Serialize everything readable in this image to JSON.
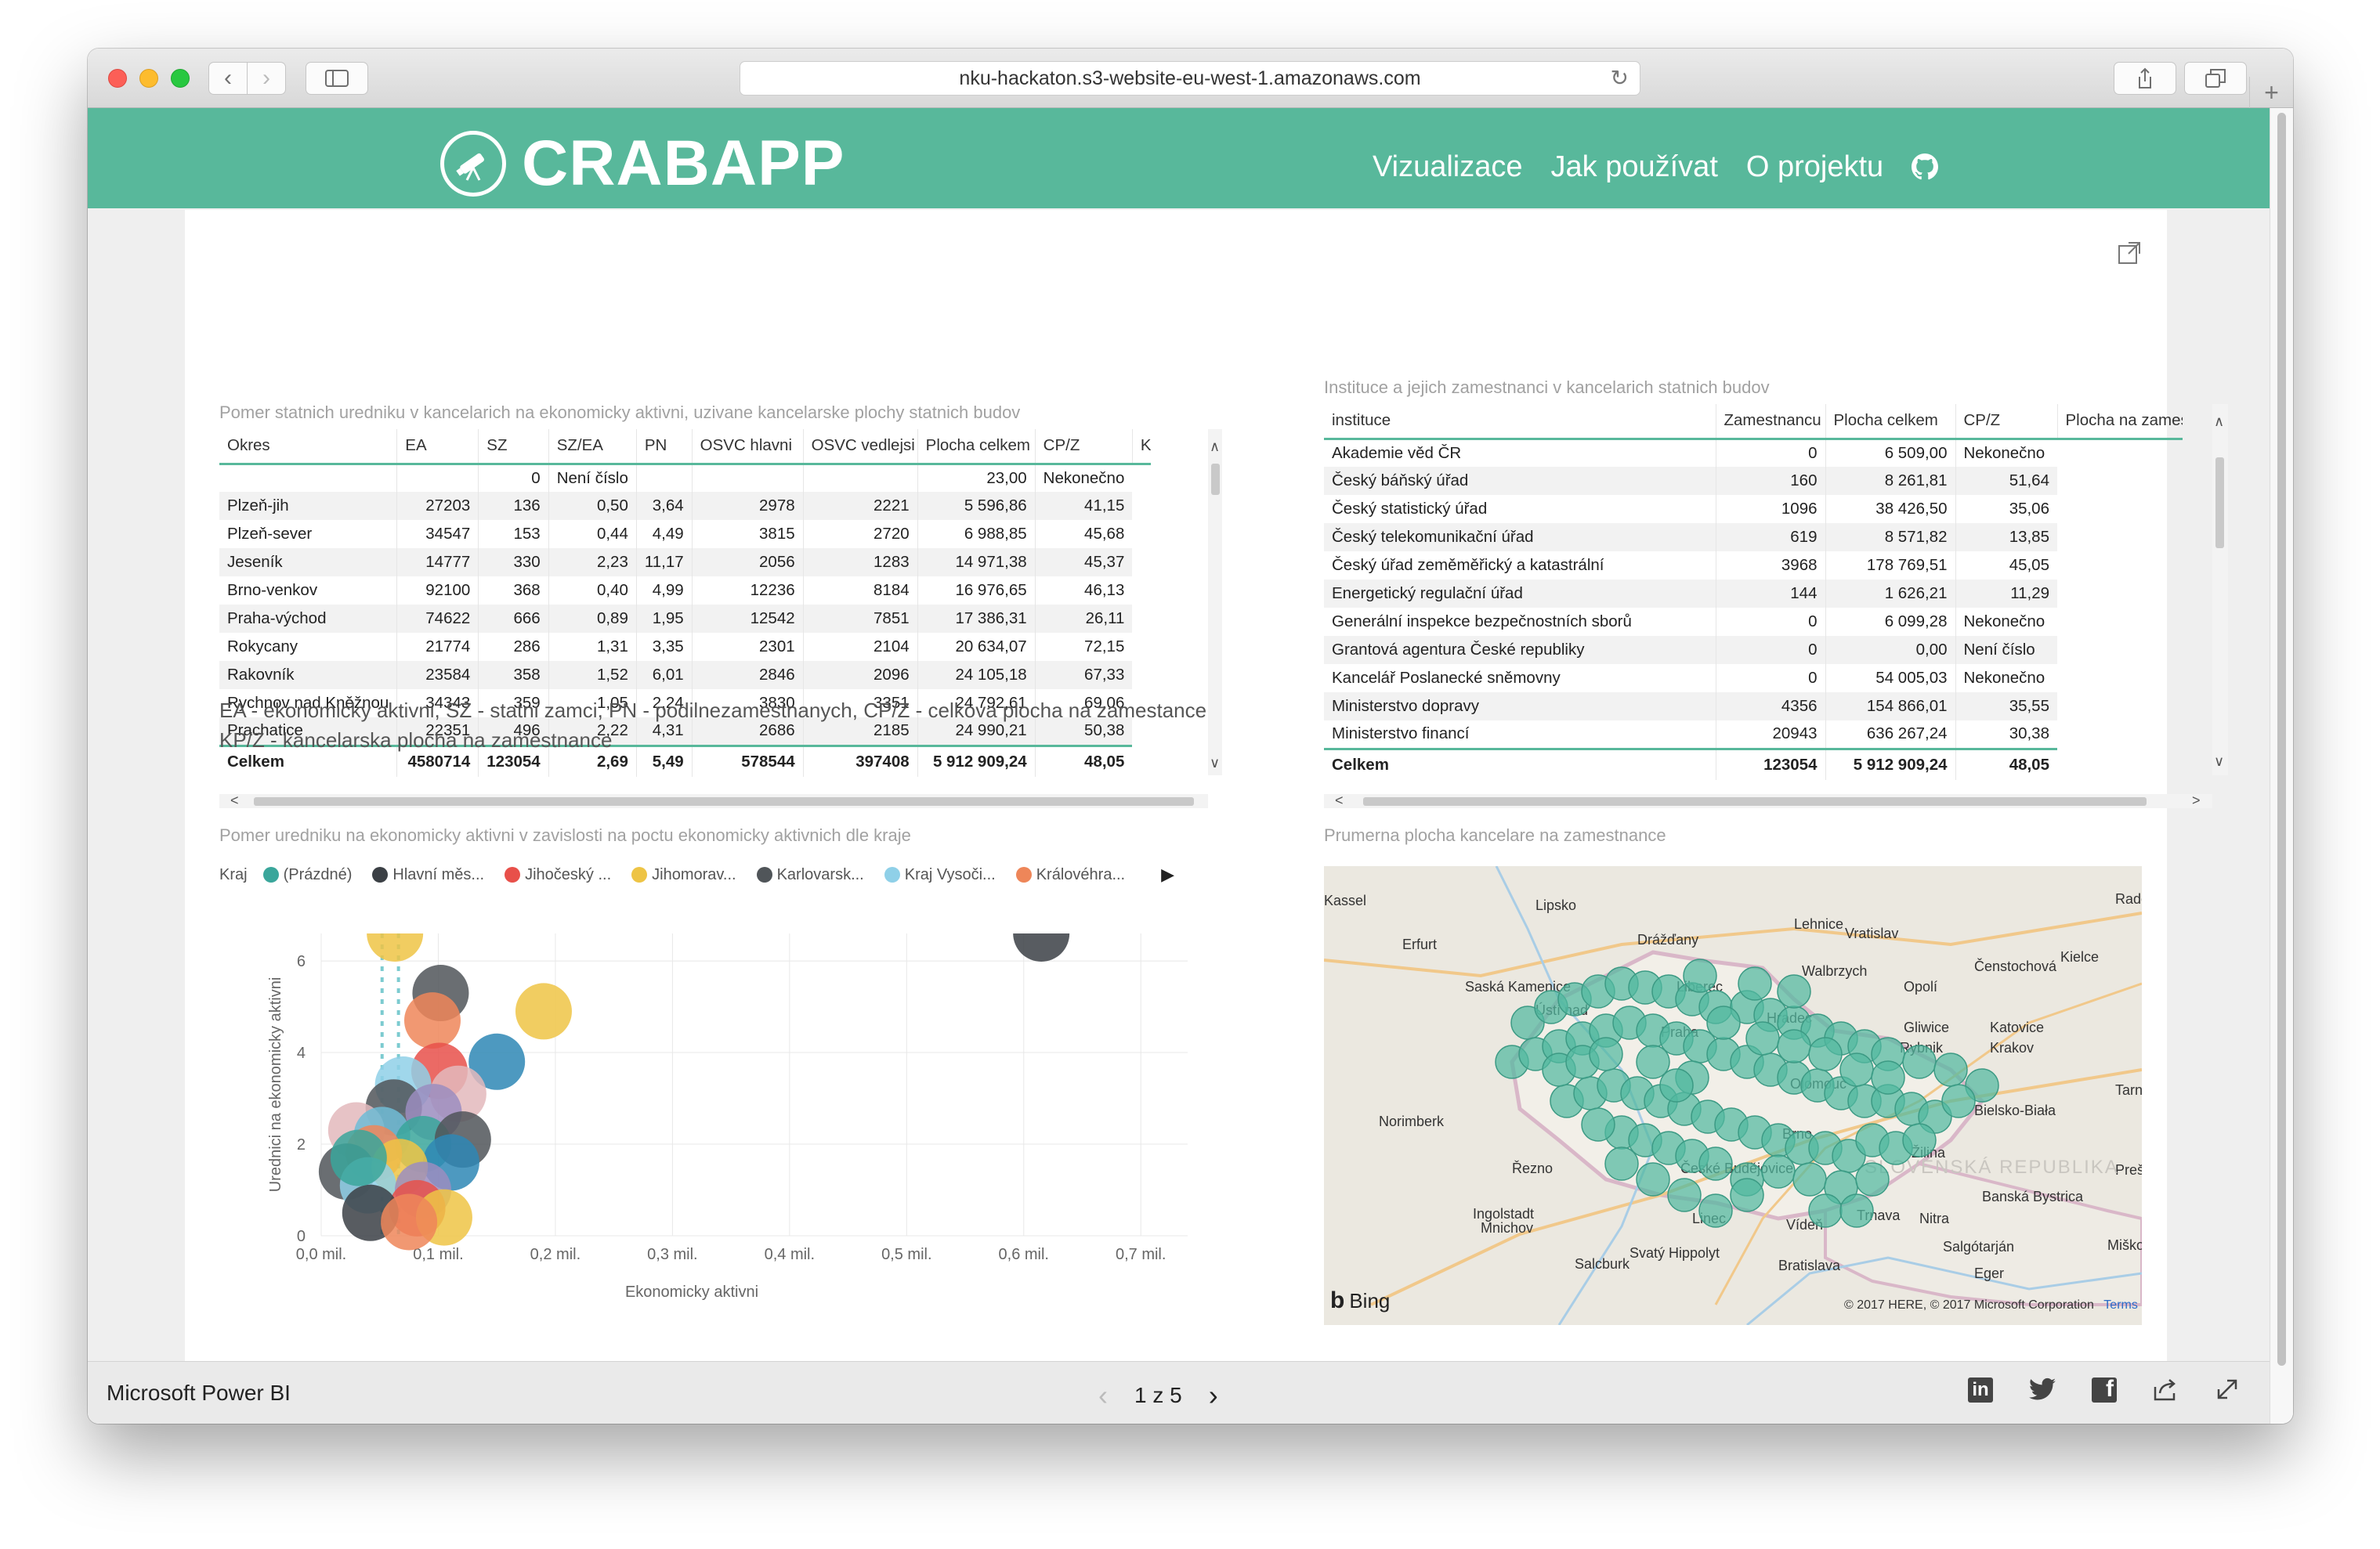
{
  "browser": {
    "url": "nku-hackaton.s3-website-eu-west-1.amazonaws.com"
  },
  "site": {
    "logo": "CRABAPP",
    "nav": [
      "Vizualizace",
      "Jak používat",
      "O projektu"
    ]
  },
  "table1": {
    "title": "Pomer statnich uredniku v kancelarich na ekonomicky aktivni, uzivane kancelarske plochy statnich budov",
    "columns": [
      "Okres",
      "EA",
      "SZ",
      "SZ/EA",
      "PN",
      "OSVC hlavni",
      "OSVC vedlejsi",
      "Plocha celkem",
      "CP/Z",
      "K"
    ],
    "rows": [
      [
        "",
        "",
        "0",
        "Není číslo",
        "",
        "",
        "",
        "23,00",
        "Nekonečno"
      ],
      [
        "Plzeň-jih",
        "27203",
        "136",
        "0,50",
        "3,64",
        "2978",
        "2221",
        "5 596,86",
        "41,15"
      ],
      [
        "Plzeň-sever",
        "34547",
        "153",
        "0,44",
        "4,49",
        "3815",
        "2720",
        "6 988,85",
        "45,68"
      ],
      [
        "Jeseník",
        "14777",
        "330",
        "2,23",
        "11,17",
        "2056",
        "1283",
        "14 971,38",
        "45,37"
      ],
      [
        "Brno-venkov",
        "92100",
        "368",
        "0,40",
        "4,99",
        "12236",
        "8184",
        "16 976,65",
        "46,13"
      ],
      [
        "Praha-východ",
        "74622",
        "666",
        "0,89",
        "1,95",
        "12542",
        "7851",
        "17 386,31",
        "26,11"
      ],
      [
        "Rokycany",
        "21774",
        "286",
        "1,31",
        "3,35",
        "2301",
        "2104",
        "20 634,07",
        "72,15"
      ],
      [
        "Rakovník",
        "23584",
        "358",
        "1,52",
        "6,01",
        "2846",
        "2096",
        "24 105,18",
        "67,33"
      ],
      [
        "Rychnov nad Kněžnou",
        "34343",
        "359",
        "1,05",
        "2,24",
        "3830",
        "3351",
        "24 792,61",
        "69,06"
      ],
      [
        "Prachatice",
        "22351",
        "496",
        "2,22",
        "4,31",
        "2686",
        "2185",
        "24 990,21",
        "50,38"
      ]
    ],
    "total": [
      "Celkem",
      "4580714",
      "123054",
      "2,69",
      "5,49",
      "578544",
      "397408",
      "5 912 909,24",
      "48,05"
    ]
  },
  "table2": {
    "title": "Instituce a jejich zamestnanci v kancelarich statnich budov",
    "columns": [
      "instituce",
      "Zamestnancu",
      "Plocha celkem",
      "CP/Z",
      "Plocha na zamestn"
    ],
    "rows": [
      [
        "Akademie věd ČR",
        "0",
        "6 509,00",
        "Nekonečno"
      ],
      [
        "Český báňský úřad",
        "160",
        "8 261,81",
        "51,64"
      ],
      [
        "Český statistický úřad",
        "1096",
        "38 426,50",
        "35,06"
      ],
      [
        "Český telekomunikační úřad",
        "619",
        "8 571,82",
        "13,85"
      ],
      [
        "Český úřad zeměměřický a katastrální",
        "3968",
        "178 769,51",
        "45,05"
      ],
      [
        "Energetický regulační úřad",
        "144",
        "1 626,21",
        "11,29"
      ],
      [
        "Generální inspekce bezpečnostních sborů",
        "0",
        "6 099,28",
        "Nekonečno"
      ],
      [
        "Grantová agentura České republiky",
        "0",
        "0,00",
        "Není číslo"
      ],
      [
        "Kancelář Poslanecké sněmovny",
        "0",
        "54 005,03",
        "Nekonečno"
      ],
      [
        "Ministerstvo dopravy",
        "4356",
        "154 866,01",
        "35,55"
      ],
      [
        "Ministerstvo financí",
        "20943",
        "636 267,24",
        "30,38"
      ]
    ],
    "total": [
      "Celkem",
      "123054",
      "5 912 909,24",
      "48,05"
    ]
  },
  "legend_note": {
    "line1": "EA - ekonomicky aktivni, SZ - statni zamci, PN - podilnezamestnanych, CP/Z - celkova plocha na zamestance",
    "line2": "KP/Z - kancelarska plocha na zamestnance"
  },
  "scatter": {
    "title": "Pomer uredniku na ekonomicky aktivni v zavislosti na poctu ekonomicky aktivnich dle kraje",
    "legend_label": "Kraj",
    "legend": [
      {
        "name": "(Prázdné)",
        "color": "#3aa69b"
      },
      {
        "name": "Hlavní měs...",
        "color": "#3b4045"
      },
      {
        "name": "Jihočeský ...",
        "color": "#e8504a"
      },
      {
        "name": "Jihomorav...",
        "color": "#eec445"
      },
      {
        "name": "Karlovarsk...",
        "color": "#505559"
      },
      {
        "name": "Kraj Vysoči...",
        "color": "#8fd0e8"
      },
      {
        "name": "Královéhra...",
        "color": "#ee8659"
      }
    ]
  },
  "chart_data": {
    "type": "scatter",
    "title": "Pomer uredniku na ekonomicky aktivni v zavislosti na poctu ekonomicky aktivnich dle kraje",
    "xlabel": "Ekonomicky aktivni",
    "ylabel": "Urednici na ekonomicky aktivni",
    "xlim": [
      0,
      0.74
    ],
    "ylim": [
      0,
      6.6
    ],
    "x_ticks": [
      "0,0 mil.",
      "0,1 mil.",
      "0,2 mil.",
      "0,3 mil.",
      "0,4 mil.",
      "0,5 mil.",
      "0,6 mil.",
      "0,7 mil."
    ],
    "x_tick_values": [
      0,
      0.1,
      0.2,
      0.3,
      0.4,
      0.5,
      0.6,
      0.7
    ],
    "y_ticks": [
      "0",
      "2",
      "4",
      "6"
    ],
    "y_tick_values": [
      0,
      2,
      4,
      6
    ],
    "grid": true,
    "points": [
      {
        "x": 0.615,
        "y": 6.6,
        "color": "#3b4045"
      },
      {
        "x": 0.063,
        "y": 6.6,
        "color": "#eec445"
      },
      {
        "x": 0.102,
        "y": 5.3,
        "color": "#505559"
      },
      {
        "x": 0.095,
        "y": 4.7,
        "color": "#ee8659"
      },
      {
        "x": 0.19,
        "y": 4.9,
        "color": "#eec445"
      },
      {
        "x": 0.15,
        "y": 3.8,
        "color": "#2e87b5"
      },
      {
        "x": 0.101,
        "y": 3.6,
        "color": "#e8504a"
      },
      {
        "x": 0.117,
        "y": 3.1,
        "color": "#e3b8bc"
      },
      {
        "x": 0.07,
        "y": 3.3,
        "color": "#8fd0e8"
      },
      {
        "x": 0.062,
        "y": 2.8,
        "color": "#505559"
      },
      {
        "x": 0.096,
        "y": 2.7,
        "color": "#9b8dbf"
      },
      {
        "x": 0.03,
        "y": 2.3,
        "color": "#e3b8bc"
      },
      {
        "x": 0.052,
        "y": 2.2,
        "color": "#6fbcd6"
      },
      {
        "x": 0.087,
        "y": 2.0,
        "color": "#3aa69b"
      },
      {
        "x": 0.121,
        "y": 2.1,
        "color": "#505559"
      },
      {
        "x": 0.111,
        "y": 1.6,
        "color": "#2e87b5"
      },
      {
        "x": 0.045,
        "y": 1.8,
        "color": "#ee8659"
      },
      {
        "x": 0.022,
        "y": 1.4,
        "color": "#505559"
      },
      {
        "x": 0.067,
        "y": 1.5,
        "color": "#eec445"
      },
      {
        "x": 0.04,
        "y": 1.1,
        "color": "#8fd0e8"
      },
      {
        "x": 0.087,
        "y": 1.0,
        "color": "#9b8dbf"
      },
      {
        "x": 0.082,
        "y": 0.6,
        "color": "#e8504a"
      },
      {
        "x": 0.105,
        "y": 0.4,
        "color": "#eec445"
      },
      {
        "x": 0.042,
        "y": 0.5,
        "color": "#3b4045"
      },
      {
        "x": 0.032,
        "y": 1.7,
        "color": "#3aa69b"
      },
      {
        "x": 0.075,
        "y": 0.3,
        "color": "#ee8659"
      }
    ]
  },
  "map": {
    "title": "Prumerna plocha kancelare na zamestnance",
    "labels": [
      "Kassel",
      "Lipsko",
      "Drážďany",
      "Erfurt",
      "Saská Kamenice",
      "Ústí nad",
      "Lehnice",
      "Vratislav",
      "Walbrzych",
      "Opolí",
      "Čenstochová",
      "Kielce",
      "Radom",
      "Gliwice",
      "Rybnik",
      "Katovice",
      "Krakov",
      "Tarnów",
      "Norimberk",
      "Řezno",
      "Ingolstadt",
      "Bielsko-Biała",
      "Žilina",
      "Banská Bystrica",
      "Nitra",
      "Trnava",
      "Vídeň",
      "Bratislava",
      "Linec",
      "Mnichov",
      "Salcburk",
      "Svatý Hippolyt",
      "Salgótarján",
      "Eger",
      "Miškovec",
      "Prešov",
      "SLOVENSKÁ REPUBLIKA",
      "Liberec",
      "Hradec",
      "Olomouc",
      "České Budějovice",
      "Praha",
      "Brno"
    ],
    "bing": "Bing",
    "copyright": "© 2017 HERE, © 2017 Microsoft Corporation",
    "terms": "Terms"
  },
  "footer": {
    "brand": "Microsoft Power BI",
    "page": "1 z 5"
  }
}
